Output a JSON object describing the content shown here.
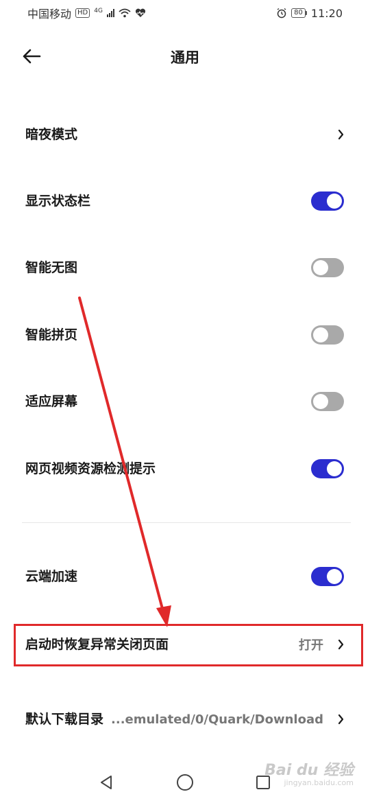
{
  "status_bar": {
    "carrier": "中国移动",
    "hd_badge": "HD",
    "network": "4G",
    "battery": "80",
    "time": "11:20"
  },
  "header": {
    "title": "通用"
  },
  "settings": {
    "dark_mode": {
      "label": "暗夜模式"
    },
    "show_status_bar": {
      "label": "显示状态栏",
      "enabled": true
    },
    "smart_no_image": {
      "label": "智能无图",
      "enabled": false
    },
    "smart_page_join": {
      "label": "智能拼页",
      "enabled": false
    },
    "fit_screen": {
      "label": "适应屏幕",
      "enabled": false
    },
    "video_detect": {
      "label": "网页视频资源检测提示",
      "enabled": true
    },
    "cloud_accel": {
      "label": "云端加速",
      "enabled": true
    },
    "restore_pages": {
      "label": "启动时恢复异常关闭页面",
      "value": "打开"
    },
    "download_dir": {
      "label": "默认下载目录",
      "value": "...emulated/0/Quark/Download"
    }
  },
  "colors": {
    "toggle_on": "#2b2dcf",
    "toggle_off": "#a9a9a9",
    "annotation": "#e0292a"
  },
  "icons": {
    "back": "arrow-left-icon",
    "chevron": "chevron-right-icon",
    "nav_back": "triangle-back-icon",
    "nav_home": "circle-home-icon",
    "nav_recent": "square-recent-icon"
  },
  "watermark": {
    "main": "Bai du 经验",
    "sub": "jingyan.baidu.com"
  }
}
